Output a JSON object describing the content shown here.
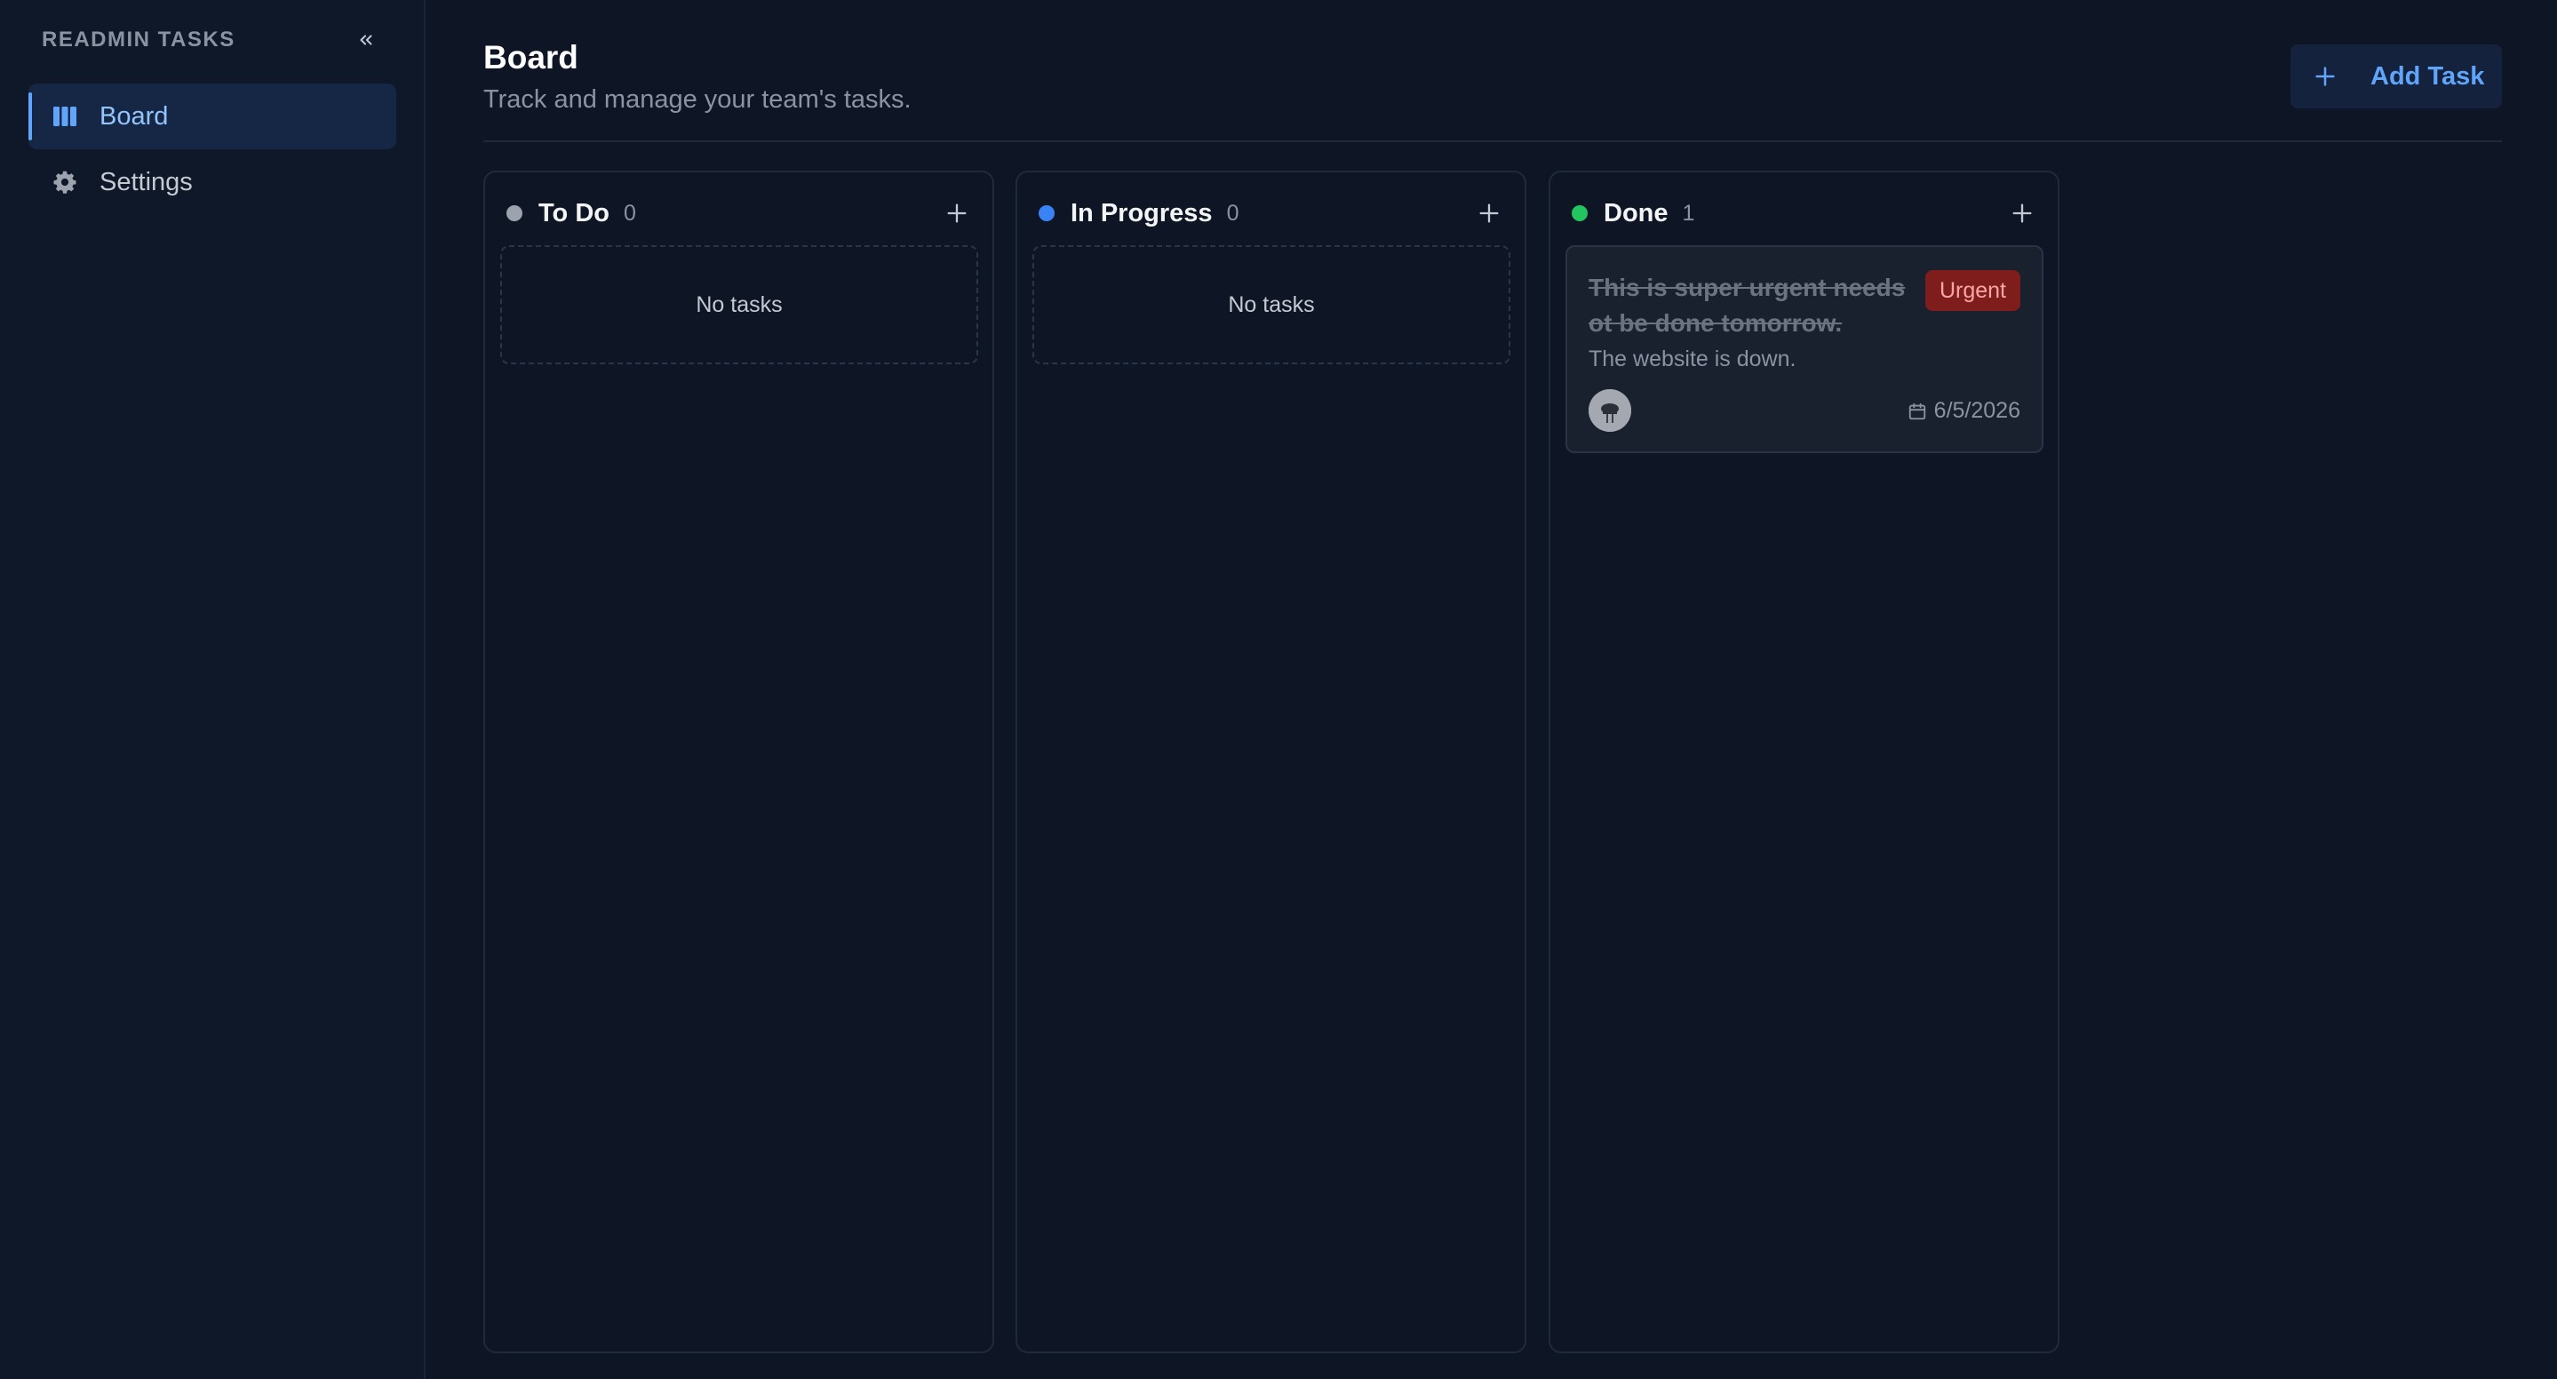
{
  "sidebar": {
    "title": "READMIN TASKS",
    "items": [
      {
        "label": "Board",
        "icon": "board-columns-icon",
        "active": true
      },
      {
        "label": "Settings",
        "icon": "gear-icon",
        "active": false
      }
    ]
  },
  "header": {
    "title": "Board",
    "subtitle": "Track and manage your team's tasks.",
    "add_task_label": "Add Task"
  },
  "columns": [
    {
      "title": "To Do",
      "count": "0",
      "color": "#9ca3af",
      "empty_text": "No tasks"
    },
    {
      "title": "In Progress",
      "count": "0",
      "color": "#3b82f6",
      "empty_text": "No tasks"
    },
    {
      "title": "Done",
      "count": "1",
      "color": "#22c55e"
    }
  ],
  "done_task": {
    "title": "This is super urgent needs ot be done tomorrow.",
    "priority": "Urgent",
    "description": "The website is down.",
    "due_date": "6/5/2026"
  },
  "colors": {
    "accent": "#60a5fa",
    "background": "#0e1626",
    "urgent_bg": "#7f1d1d",
    "urgent_text": "#fca5a5"
  }
}
